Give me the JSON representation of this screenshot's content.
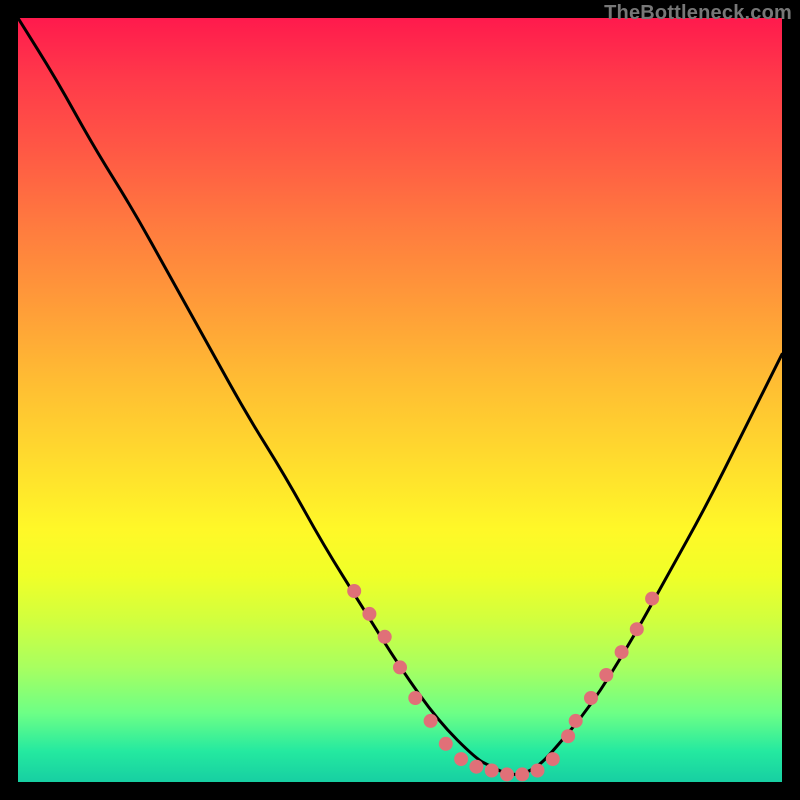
{
  "watermark": "TheBottleneck.com",
  "colors": {
    "curve": "#000000",
    "markers": "#e07078",
    "gradient_top": "#ff1a4d",
    "gradient_bottom": "#17cfa2"
  },
  "chart_data": {
    "type": "line",
    "title": "",
    "xlabel": "",
    "ylabel": "",
    "xlim": [
      0,
      100
    ],
    "ylim": [
      0,
      100
    ],
    "grid": false,
    "x": [
      0,
      5,
      10,
      15,
      20,
      25,
      30,
      35,
      40,
      45,
      50,
      55,
      60,
      62,
      64,
      66,
      68,
      70,
      75,
      80,
      85,
      90,
      95,
      100
    ],
    "y": [
      100,
      92,
      83,
      75,
      66,
      57,
      48,
      40,
      31,
      23,
      15,
      8,
      3,
      2,
      1,
      1,
      2,
      4,
      10,
      18,
      27,
      36,
      46,
      56
    ],
    "series": [
      {
        "name": "marker-points",
        "comment": "pink dots visible near the valley and on the ascending branch",
        "x": [
          44,
          46,
          48,
          50,
          52,
          54,
          56,
          58,
          60,
          62,
          64,
          66,
          68,
          70,
          72,
          73,
          75,
          77,
          79,
          81,
          83
        ],
        "y": [
          25,
          22,
          19,
          15,
          11,
          8,
          5,
          3,
          2,
          1.5,
          1,
          1,
          1.5,
          3,
          6,
          8,
          11,
          14,
          17,
          20,
          24
        ]
      }
    ]
  }
}
